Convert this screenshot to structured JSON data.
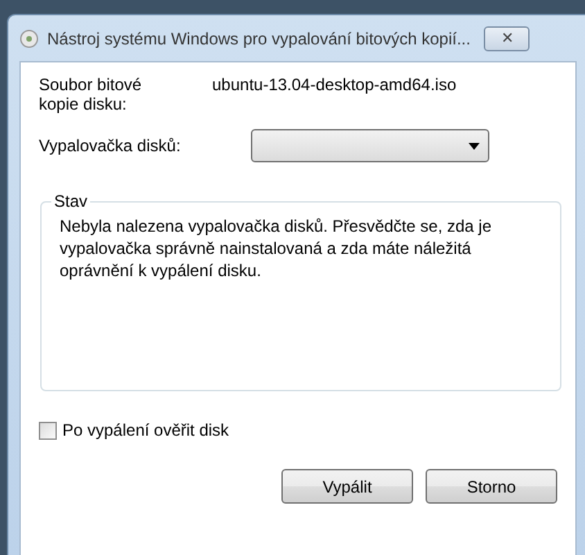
{
  "window": {
    "title": "Nástroj systému Windows pro vypalování bitových kopií...",
    "close": "✕"
  },
  "image_file": {
    "label": "Soubor bitové kopie disku:",
    "value": "ubuntu-13.04-desktop-amd64.iso"
  },
  "burner": {
    "label": "Vypalovačka disků:"
  },
  "status": {
    "legend": "Stav",
    "message": "Nebyla nalezena vypalovačka disků. Přesvědčte se, zda je vypalovačka správně nainstalovaná a zda máte náležitá oprávnění k vypálení disku."
  },
  "verify": {
    "label": "Po vypálení ověřit disk",
    "checked": false
  },
  "buttons": [
    {
      "label": "Vypálit"
    },
    {
      "label": "Storno"
    }
  ]
}
